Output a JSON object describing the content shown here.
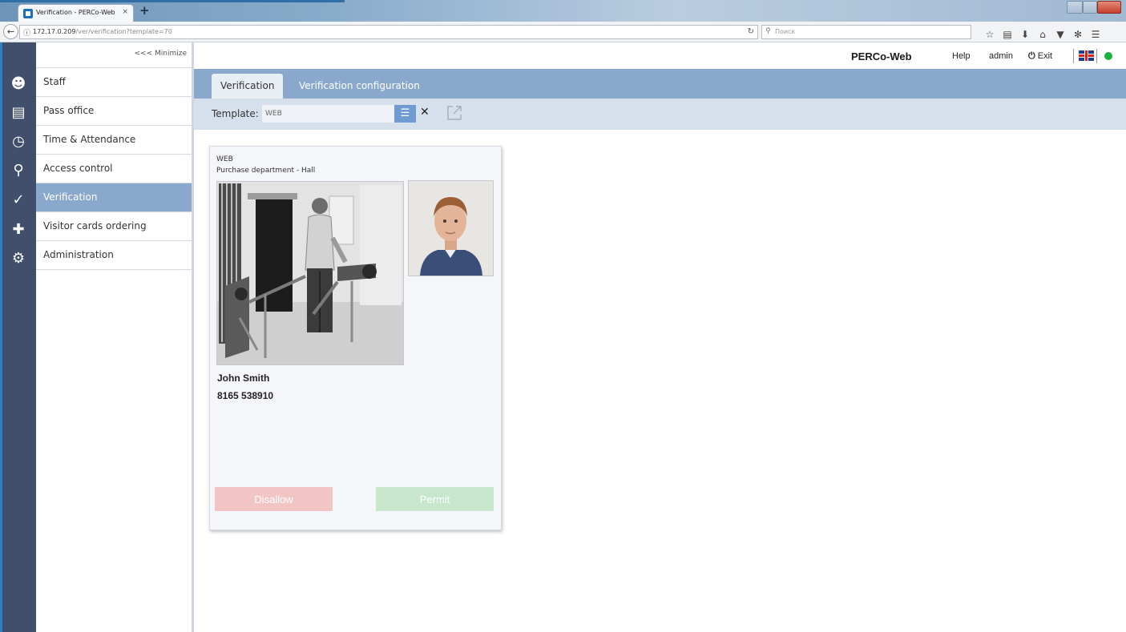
{
  "browser": {
    "tab_title": "Verification - PERCo-Web",
    "tab_close": "×",
    "new_tab": "+",
    "url_host": "172.17.0.209",
    "url_path": "/ver/verification?template=70",
    "search_placeholder": "Поиск"
  },
  "sidebar": {
    "minimize_label": "<<< Minimize",
    "items": [
      {
        "label": "Staff",
        "icon": "staff-icon"
      },
      {
        "label": "Pass office",
        "icon": "pass-office-icon"
      },
      {
        "label": "Time & Attendance",
        "icon": "time-attendance-icon"
      },
      {
        "label": "Access control",
        "icon": "access-control-icon"
      },
      {
        "label": "Verification",
        "icon": "verification-icon",
        "active": true
      },
      {
        "label": "Visitor cards ordering",
        "icon": "visitor-cards-icon"
      },
      {
        "label": "Administration",
        "icon": "administration-icon"
      }
    ]
  },
  "header": {
    "brand": "PERCo-Web",
    "help": "Help",
    "user": "admin",
    "exit": "Exit",
    "status_color": "#19b23a"
  },
  "tabs": [
    {
      "label": "Verification",
      "active": true
    },
    {
      "label": "Verification configuration",
      "active": false
    }
  ],
  "toolbar": {
    "template_label": "Template:",
    "template_value": "WEB"
  },
  "card": {
    "template_name": "WEB",
    "location": "Purchase department - Hall",
    "person_name": "John Smith",
    "card_number": "8165 538910",
    "disallow_label": "Disallow",
    "permit_label": "Permit"
  },
  "colors": {
    "accent": "#8aa8cb",
    "dark_strip": "#3f4f6c",
    "disallow": "#f1c5c4",
    "permit": "#c8e6cc"
  }
}
